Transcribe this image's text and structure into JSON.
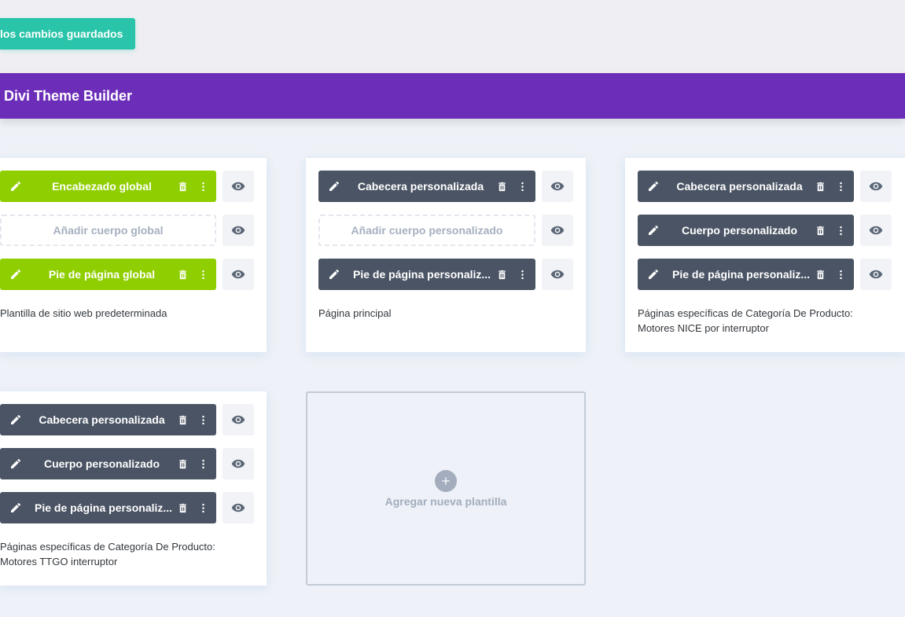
{
  "toolbar": {
    "save_label": "los cambios guardados"
  },
  "header": {
    "title": "Divi Theme Builder"
  },
  "colors": {
    "accent_purple": "#6c2eb9",
    "save_green": "#29c4a9",
    "global_green": "#8fce00",
    "dark_pill": "#4a5464"
  },
  "icons": {
    "edit": "pencil-icon",
    "delete": "trash-icon",
    "more": "more-vertical-icon",
    "visibility": "eye-icon",
    "add": "plus-icon"
  },
  "templates": [
    {
      "header": "Encabezado global",
      "body_add": "Añadir cuerpo global",
      "footer": "Pie de página global",
      "caption": "Plantilla de sitio web predeterminada"
    },
    {
      "header": "Cabecera personalizada",
      "body_add": "Añadir cuerpo personalizado",
      "footer": "Pie de página personaliz...",
      "caption": "Página principal"
    },
    {
      "header": "Cabecera personalizada",
      "body": "Cuerpo personalizado",
      "footer": "Pie de página personaliz...",
      "caption_line1": "Páginas específicas de Categoría De Producto:",
      "caption_line2": "Motores NICE por interruptor"
    },
    {
      "header": "Cabecera personalizada",
      "body": "Cuerpo personalizado",
      "footer": "Pie de página personaliz...",
      "caption_line1": "Páginas específicas de Categoría De Producto:",
      "caption_line2": "Motores TTGO interruptor"
    }
  ],
  "add_template": {
    "label": "Agregar nueva plantilla"
  }
}
